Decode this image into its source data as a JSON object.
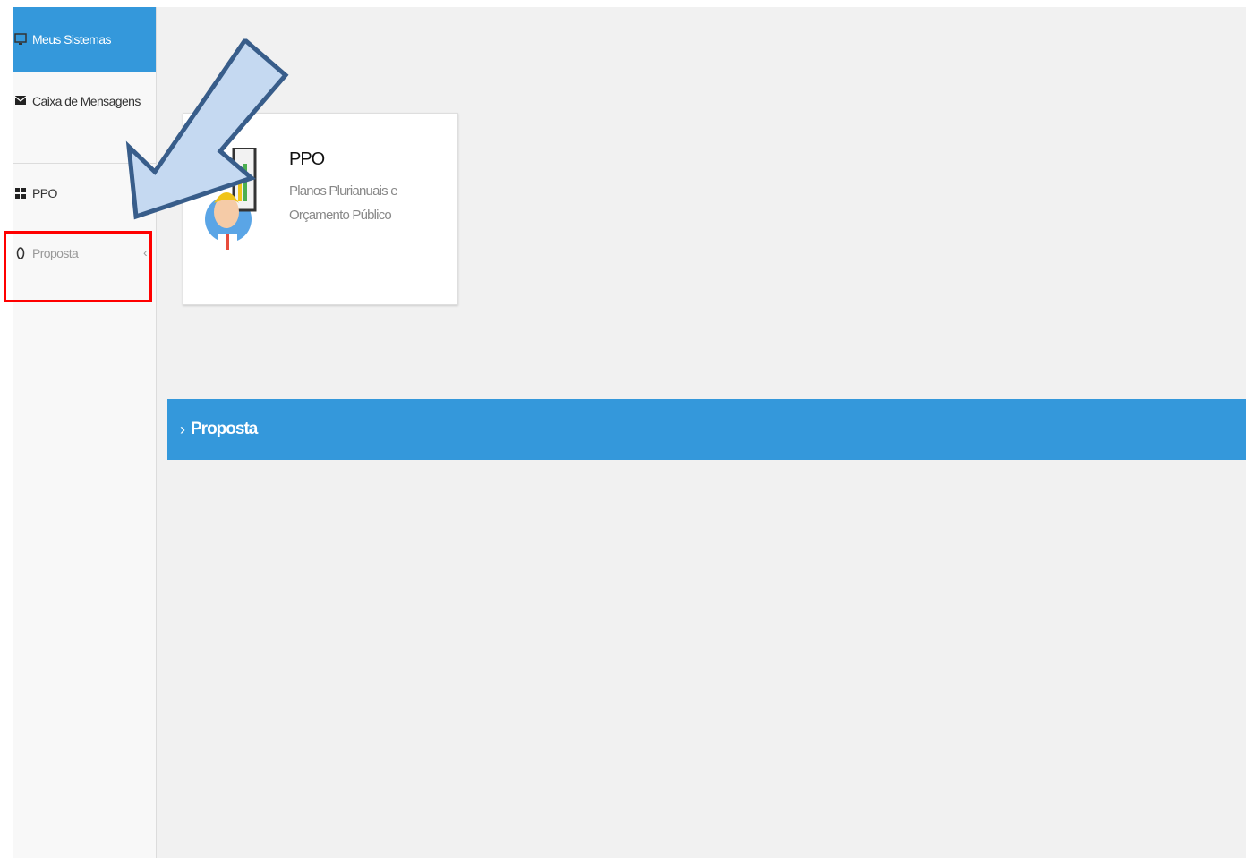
{
  "sidebar": {
    "items": [
      {
        "label": "Meus Sistemas",
        "icon": "monitor-icon",
        "active": true
      },
      {
        "label": "Caixa de Mensagens",
        "icon": "envelope-icon"
      },
      {
        "label": "PPO",
        "icon": "grid-icon"
      },
      {
        "label": "Proposta",
        "icon": "circle-icon",
        "expand_icon": "chevron-left-icon"
      }
    ]
  },
  "card": {
    "title": "PPO",
    "description": "Planos Plurianuais e Orçamento Público",
    "icon": "analyst-avatar-icon"
  },
  "section": {
    "label": "Proposta",
    "icon": "chevron-right-icon"
  },
  "annotation": {
    "arrow_icon": "pointer-arrow-icon",
    "highlight_color": "#ff0000",
    "arrow_color": "#c5d9f1"
  },
  "colors": {
    "accent": "#3498db",
    "background": "#f1f1f1",
    "sidebar": "#f8f8f8"
  }
}
